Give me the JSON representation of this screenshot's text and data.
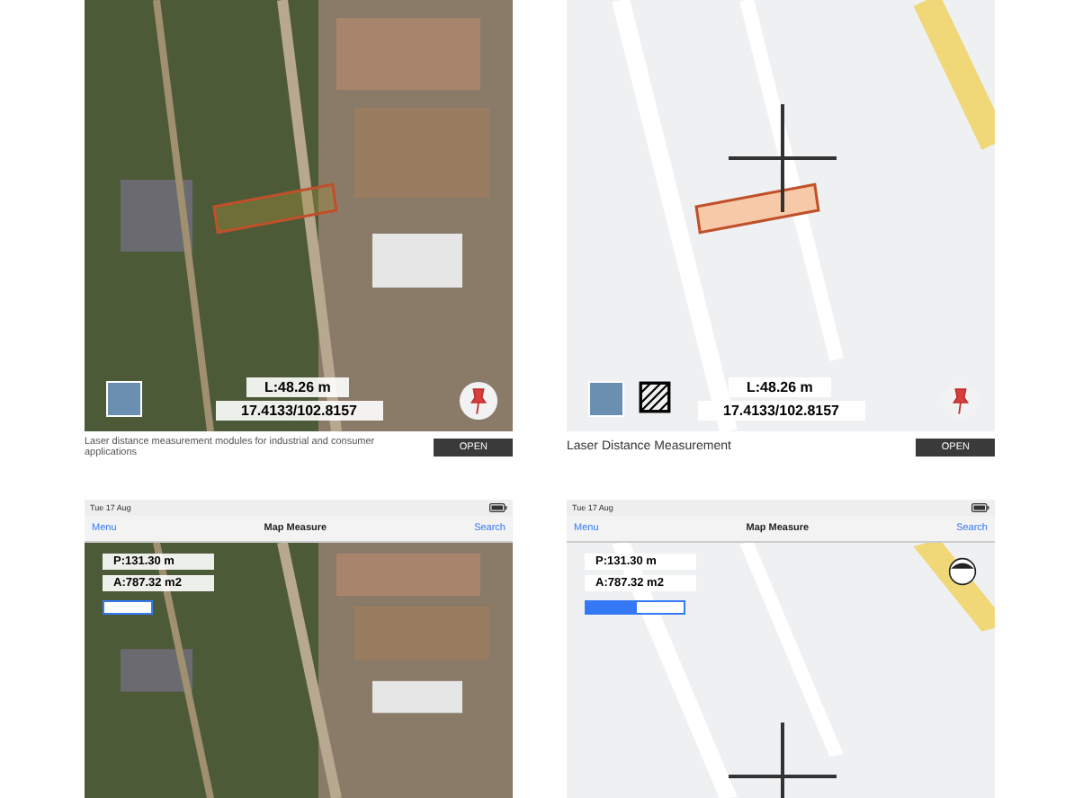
{
  "panels": [
    {
      "kind": "satellite",
      "length": "L:48.26 m",
      "coords": "17.4133/102.8157",
      "ad": {
        "text": "Laser distance measurement modules for industrial and consumer applications",
        "button": "OPEN"
      }
    },
    {
      "kind": "street",
      "length": "L:48.26 m",
      "coords": "17.4133/102.8157",
      "ad": {
        "text": "Laser Distance Measurement",
        "button": "OPEN"
      }
    },
    {
      "kind": "satellite_app",
      "date": "Tue 17 Aug",
      "nav": {
        "left": "Menu",
        "title": "Map Measure",
        "right": "Search"
      },
      "perimeter": "P:131.30 m",
      "area": "A:787.32 m2",
      "segments": [
        {
          "selected": false
        }
      ]
    },
    {
      "kind": "street_app",
      "date": "Tue 17 Aug",
      "nav": {
        "left": "Menu",
        "title": "Map Measure",
        "right": "Search"
      },
      "perimeter": "P:131.30 m",
      "area": "A:787.32 m2",
      "segments": [
        {
          "selected": true
        },
        {
          "selected": false
        }
      ]
    }
  ]
}
